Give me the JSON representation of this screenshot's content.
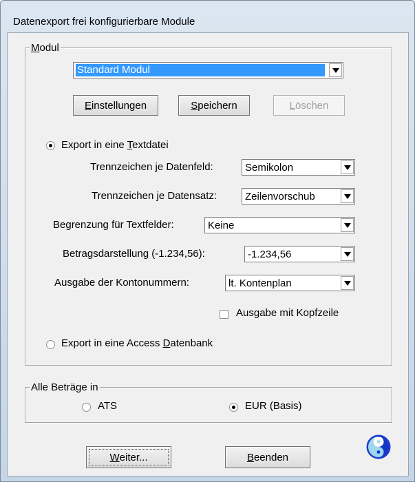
{
  "window": {
    "title": "Datenexport frei konfigurierbare Module"
  },
  "modul_group": {
    "legend": "Modul",
    "legend_key": "M",
    "legend_rest": "odul",
    "module_combo": {
      "value": "Standard Modul"
    },
    "buttons": {
      "einstellungen": {
        "key": "E",
        "rest": "instellungen"
      },
      "speichern": {
        "key": "S",
        "rest": "peichern"
      },
      "loeschen": {
        "key": "L",
        "rest": "öschen"
      }
    },
    "export_text": {
      "pre": "Export in eine ",
      "key": "T",
      "rest": "extdatei",
      "checked": true
    },
    "fields": [
      {
        "label": "Trennzeichen je Datenfeld:",
        "value": "Semikolon"
      },
      {
        "label": "Trennzeichen je Datensatz:",
        "value": "Zeilenvorschub"
      },
      {
        "label": "Begrenzung für Textfelder:",
        "value": "Keine"
      },
      {
        "label": "Betragsdarstellung (-1.234,56):",
        "value": "-1.234,56"
      },
      {
        "label": "Ausgabe der Kontonummern:",
        "value": "lt. Kontenplan"
      }
    ],
    "kopfzeile": {
      "label": "Ausgabe mit Kopfzeile",
      "checked": false
    },
    "export_access": {
      "pre": "Export in eine Access ",
      "key": "D",
      "rest": "atenbank",
      "checked": false
    }
  },
  "currency_group": {
    "legend": "Alle Beträge in",
    "ats": {
      "label": "ATS",
      "checked": false
    },
    "eur": {
      "label": "EUR (Basis)",
      "checked": true
    }
  },
  "footer": {
    "weiter": {
      "key": "W",
      "rest": "eiter..."
    },
    "beenden": {
      "key": "B",
      "rest": "eenden"
    }
  },
  "icons": {
    "logo": "app-logo-icon",
    "dropdown": "chevron-down-icon"
  }
}
